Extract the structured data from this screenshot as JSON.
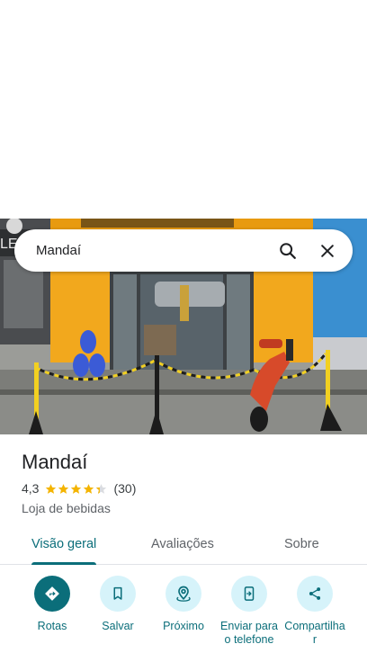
{
  "search": {
    "value": "Mandaí",
    "search_icon": "search-icon",
    "close_icon": "close-icon"
  },
  "photo": {
    "storefront_sign_partial": "LE"
  },
  "place": {
    "name": "Mandaí",
    "rating": "4,3",
    "rating_value": 4.3,
    "stars_max": 5,
    "reviews": "(30)",
    "category": "Loja de bebidas"
  },
  "tabs": [
    {
      "label": "Visão geral",
      "active": true
    },
    {
      "label": "Avaliações",
      "active": false
    },
    {
      "label": "Sobre",
      "active": false
    }
  ],
  "actions": [
    {
      "label": "Rotas",
      "icon": "directions-icon"
    },
    {
      "label": "Salvar",
      "icon": "bookmark-icon"
    },
    {
      "label": "Próximo",
      "icon": "nearby-icon"
    },
    {
      "label": "Enviar para o telefone",
      "icon": "send-to-phone-icon"
    },
    {
      "label": "Compartilhar",
      "icon": "share-icon"
    }
  ],
  "colors": {
    "accent": "#0b6e7a",
    "action_bg": "#d6f3fa",
    "star": "#f4b400",
    "wall_yellow": "#f2a81d",
    "wall_blue": "#3a8fd0"
  }
}
